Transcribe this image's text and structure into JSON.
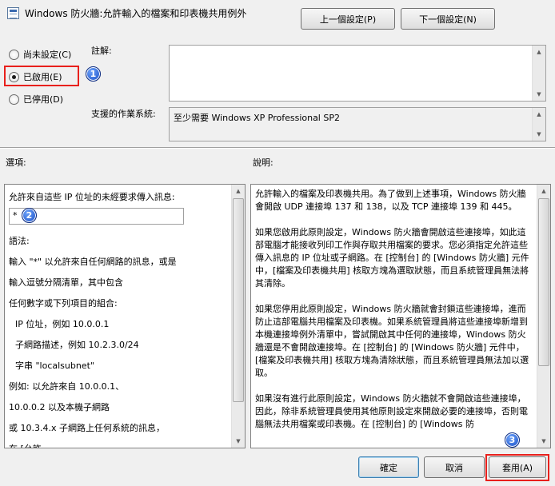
{
  "window": {
    "title": "Windows 防火牆:允許輸入的檔案和印表機共用例外",
    "prev_setting_label": "上一個設定(P)",
    "next_setting_label": "下一個設定(N)"
  },
  "state_options": [
    {
      "label": "尚未設定(C)",
      "checked": false
    },
    {
      "label": "已啟用(E)",
      "checked": true
    },
    {
      "label": "已停用(D)",
      "checked": false
    }
  ],
  "comment": {
    "label": "註解:",
    "value": ""
  },
  "supported_on": {
    "label": "支援的作業系統:",
    "value": "至少需要 Windows XP Professional SP2"
  },
  "options": {
    "label": "選項:",
    "prompt": "允許來自這些 IP 位址的未經要求傳入訊息:",
    "input_value": "*",
    "lines": [
      "語法:",
      "輸入 \"*\" 以允許來自任何網路的訊息，或是",
      "輸入逗號分隔清單，其中包含",
      "任何數字或下列項目的組合:",
      " IP 位址，例如 10.0.0.1",
      " 子網路描述，例如 10.2.3.0/24",
      " 字串 \"localsubnet\"",
      "例如: 以允許來自 10.0.0.1、",
      "10.0.0.2 以及本機子網路",
      "或 10.3.4.x 子網路上任何系統的訊息，",
      "在 [允許"
    ]
  },
  "help": {
    "label": "說明:",
    "paragraphs": [
      "允許輸入的檔案及印表機共用。為了做到上述事項，Windows 防火牆會開啟 UDP 連接埠 137 和 138，以及 TCP 連接埠 139 和 445。",
      "如果您啟用此原則設定，Windows 防火牆會開啟這些連接埠，如此這部電腦才能接收列印工作與存取共用檔案的要求。您必須指定允許這些傳入訊息的 IP 位址或子網路。在 [控制台] 的 [Windows 防火牆] 元件中，[檔案及印表機共用] 核取方塊為選取狀態，而且系統管理員無法將其清除。",
      "如果您停用此原則設定，Windows 防火牆就會封鎖這些連接埠，進而防止這部電腦共用檔案及印表機。如果系統管理員將這些連接埠新增到本機連接埠例外清單中，嘗試開啟其中任何的連接埠，Windows 防火牆還是不會開啟連接埠。在 [控制台] 的 [Windows 防火牆] 元件中，[檔案及印表機共用] 核取方塊為清除狀態，而且系統管理員無法加以選取。",
      "如果沒有進行此原則設定，Windows 防火牆就不會開啟這些連接埠，因此，除非系統管理員使用其他原則設定來開啟必要的連接埠，否則電腦無法共用檔案或印表機。在 [控制台] 的 [Windows 防"
    ]
  },
  "buttons": {
    "ok": "確定",
    "cancel": "取消",
    "apply": "套用(A)"
  },
  "badges": [
    "1",
    "2",
    "3"
  ],
  "colors": {
    "highlight": "#e8201c",
    "badge": "#1a50c8"
  }
}
